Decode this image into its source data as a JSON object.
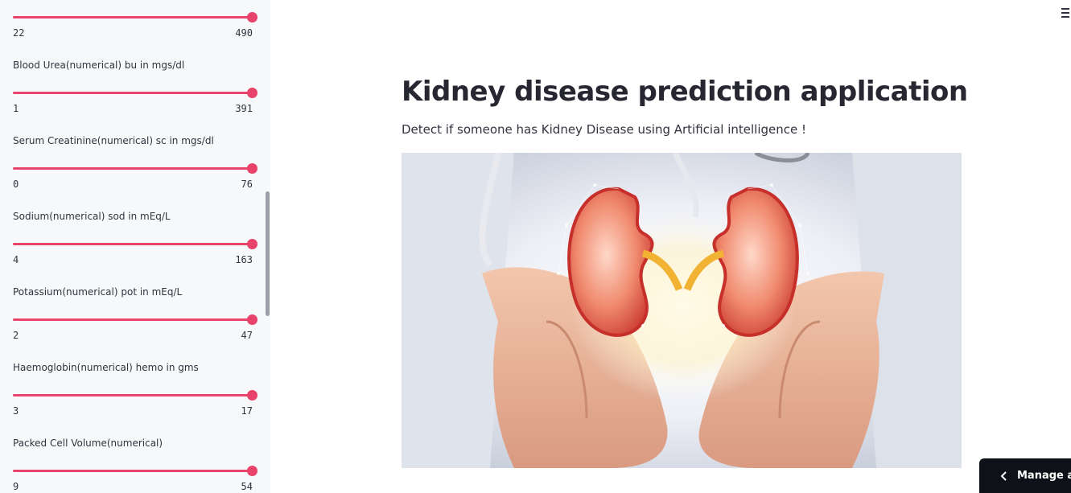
{
  "sidebar": {
    "sliders": [
      {
        "label": "",
        "min": "22",
        "max": "490",
        "value": 490
      },
      {
        "label": "Blood Urea(numerical) bu in mgs/dl",
        "min": "1",
        "max": "391",
        "value": 391
      },
      {
        "label": "Serum Creatinine(numerical) sc in mgs/dl",
        "min": "0",
        "max": "76",
        "value": 76
      },
      {
        "label": "Sodium(numerical) sod in mEq/L",
        "min": "4",
        "max": "163",
        "value": 163
      },
      {
        "label": "Potassium(numerical) pot in mEq/L",
        "min": "2",
        "max": "47",
        "value": 47
      },
      {
        "label": "Haemoglobin(numerical) hemo in gms",
        "min": "3",
        "max": "17",
        "value": 17
      },
      {
        "label": "Packed Cell Volume(numerical)",
        "min": "9",
        "max": "54",
        "value": 54
      }
    ]
  },
  "main": {
    "title": "Kidney disease prediction application",
    "subtitle": "Detect if someone has Kidney Disease using Artificial intelligence !"
  },
  "manage_app": {
    "label": "Manage app"
  },
  "colors": {
    "accent": "#e8436b",
    "sidebar_bg": "#f7f8fa",
    "dark_button": "#0e1117"
  },
  "icons": {
    "menu": "hamburger-icon",
    "manage_chevron": "chevron-left-icon"
  }
}
